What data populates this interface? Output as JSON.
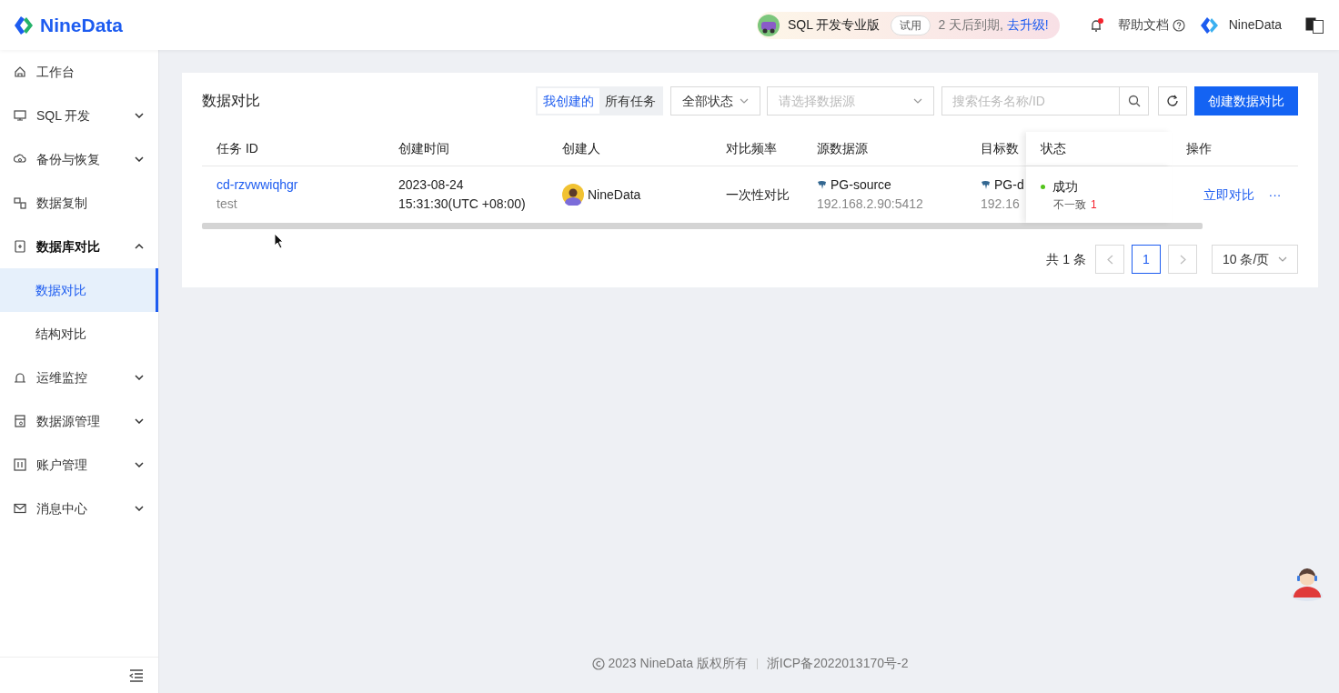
{
  "header": {
    "logo": "NineData",
    "promo": {
      "product": "SQL 开发专业版",
      "badge": "试用",
      "expiry": "2 天后到期, ",
      "upgrade": "去升级!"
    },
    "notifications": {
      "unread": true
    },
    "help": "帮助文档",
    "user": "NineData"
  },
  "sidebar": {
    "items": [
      {
        "kind": "link",
        "label": "工作台"
      },
      {
        "kind": "group",
        "label": "SQL 开发",
        "expanded": false
      },
      {
        "kind": "group",
        "label": "备份与恢复",
        "expanded": false
      },
      {
        "kind": "link",
        "label": "数据复制"
      },
      {
        "kind": "group",
        "label": "数据库对比",
        "expanded": true,
        "children": [
          {
            "label": "数据对比",
            "selected": true
          },
          {
            "label": "结构对比",
            "selected": false
          }
        ]
      },
      {
        "kind": "group",
        "label": "运维监控",
        "expanded": false
      },
      {
        "kind": "group",
        "label": "数据源管理",
        "expanded": false
      },
      {
        "kind": "group",
        "label": "账户管理",
        "expanded": false
      },
      {
        "kind": "group",
        "label": "消息中心",
        "expanded": false
      }
    ]
  },
  "main": {
    "title": "数据对比",
    "scope_tabs": [
      {
        "label": "我创建的",
        "selected": true
      },
      {
        "label": "所有任务",
        "selected": false
      }
    ],
    "status_filter": "全部状态",
    "datasource_select": {
      "placeholder": "请选择数据源"
    },
    "search": {
      "placeholder": "搜索任务名称/ID"
    },
    "create_button": "创建数据对比",
    "table": {
      "columns": [
        "任务 ID",
        "创建时间",
        "创建人",
        "对比频率",
        "源数据源",
        "目标数",
        "状态",
        "操作"
      ],
      "rows": [
        {
          "task_id": "cd-rzvwwiqhgr",
          "task_name": "test",
          "created_date": "2023-08-24",
          "created_time": "15:31:30(UTC +08:00)",
          "creator": "NineData",
          "frequency": "一次性对比",
          "source": {
            "name": "PG-source",
            "address": "192.168.2.90:5412"
          },
          "target": {
            "name": "PG-d",
            "address": "192.16"
          },
          "status": {
            "label": "成功",
            "color": "#52c41a"
          },
          "inconsistent": {
            "label": "不一致",
            "count": "1"
          },
          "action": "立即对比",
          "more": "···"
        }
      ]
    },
    "pagination": {
      "total": "共 1 条",
      "prev_disabled": true,
      "pages": [
        {
          "label": "1",
          "selected": true
        }
      ],
      "next_disabled": true,
      "page_size": "10 条/页"
    }
  },
  "footer": {
    "copyright": "2023 NineData 版权所有",
    "icp": "浙ICP备2022013170号-2"
  }
}
